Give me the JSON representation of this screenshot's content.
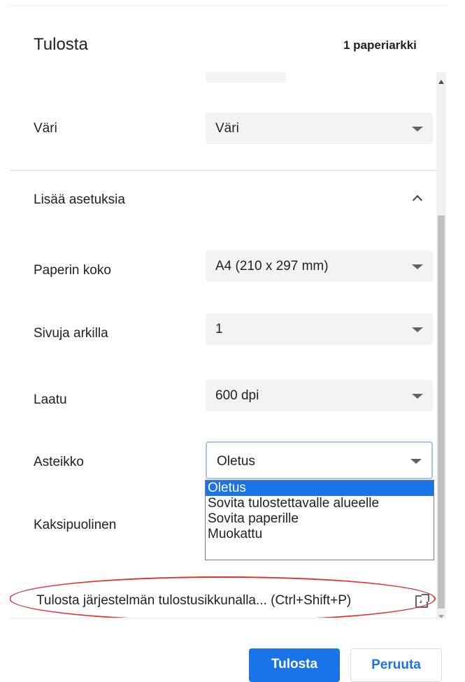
{
  "header": {
    "title": "Tulosta",
    "sheet_count": "1 paperiarkki"
  },
  "settings": {
    "color": {
      "label": "Väri",
      "value": "Väri"
    },
    "more_settings_label": "Lisää asetuksia",
    "paper_size": {
      "label": "Paperin koko",
      "value": "A4 (210 x 297 mm)"
    },
    "pages_per_sheet": {
      "label": "Sivuja arkilla",
      "value": "1"
    },
    "quality": {
      "label": "Laatu",
      "value": "600 dpi"
    },
    "scale": {
      "label": "Asteikko",
      "value": "Oletus",
      "options": [
        "Oletus",
        "Sovita tulostettavalle alueelle",
        "Sovita paperille",
        "Muokattu"
      ]
    },
    "duplex": {
      "label": "Kaksipuolinen"
    }
  },
  "system_dialog_link": "Tulosta järjestelmän tulostusikkunalla... (Ctrl+Shift+P)",
  "buttons": {
    "print": "Tulosta",
    "cancel": "Peruuta"
  },
  "colors": {
    "accent": "#1a73e8",
    "annotation": "#e03030",
    "select_background": "#f1f3f4"
  }
}
